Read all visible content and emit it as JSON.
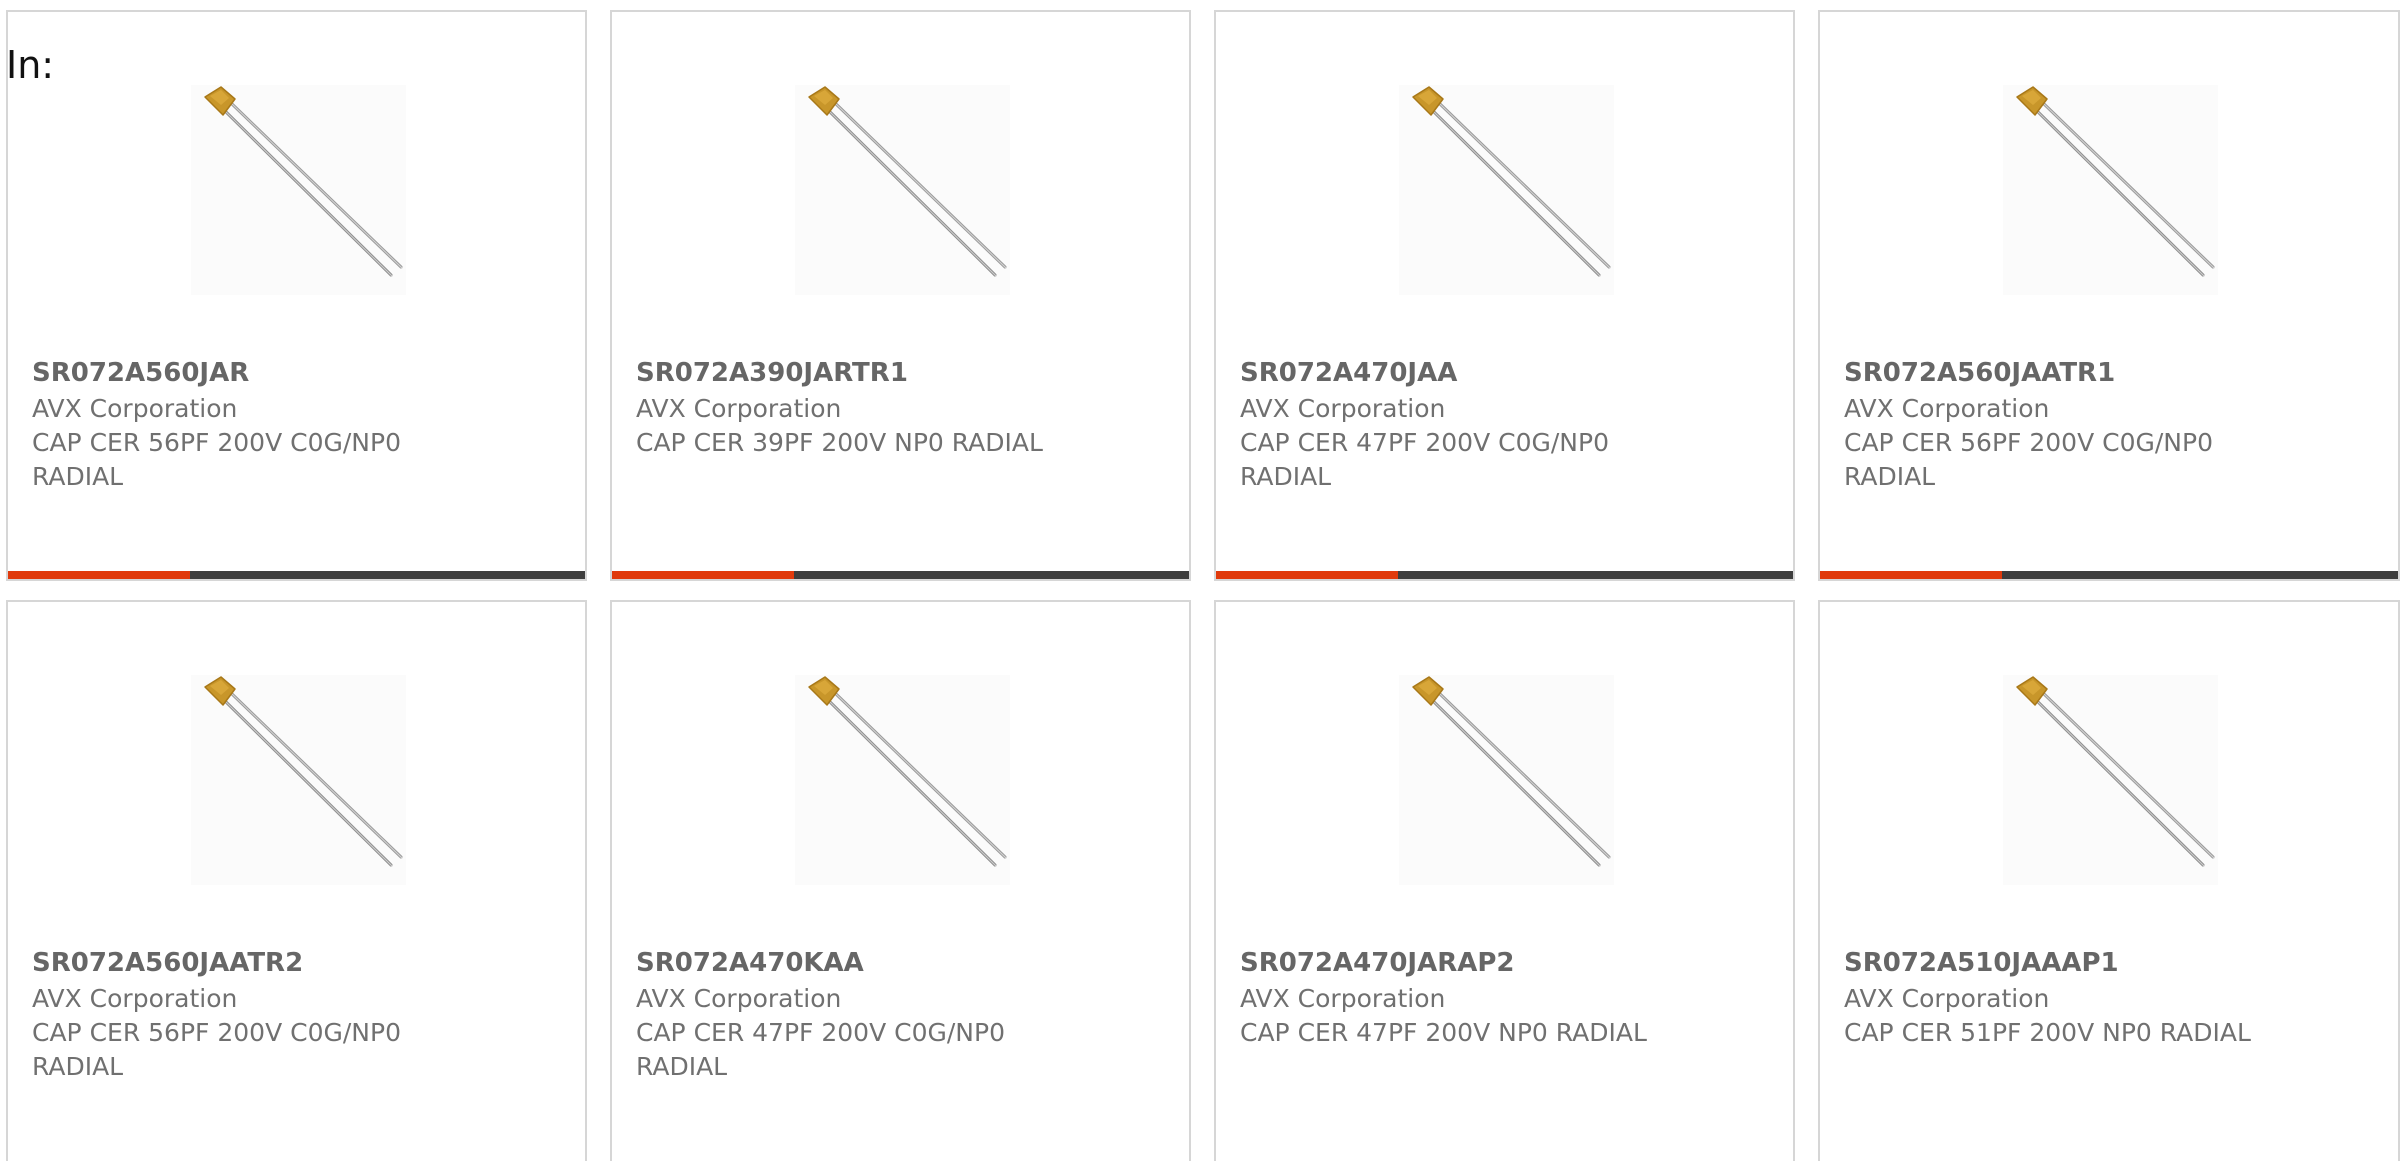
{
  "filter": {
    "label": "In:"
  },
  "cards": [
    {
      "part_number": "SR072A560JAR",
      "manufacturer": "AVX Corporation",
      "description": "CAP CER 56PF 200V C0G/NP0 RADIAL"
    },
    {
      "part_number": "SR072A390JARTR1",
      "manufacturer": "AVX Corporation",
      "description": "CAP CER 39PF 200V NP0 RADIAL"
    },
    {
      "part_number": "SR072A470JAA",
      "manufacturer": "AVX Corporation",
      "description": "CAP CER 47PF 200V C0G/NP0 RADIAL"
    },
    {
      "part_number": "SR072A560JAATR1",
      "manufacturer": "AVX Corporation",
      "description": "CAP CER 56PF 200V C0G/NP0 RADIAL"
    },
    {
      "part_number": "SR072A560JAATR2",
      "manufacturer": "AVX Corporation",
      "description": "CAP CER 56PF 200V C0G/NP0 RADIAL"
    },
    {
      "part_number": "SR072A470KAA",
      "manufacturer": "AVX Corporation",
      "description": "CAP CER 47PF 200V C0G/NP0 RADIAL"
    },
    {
      "part_number": "SR072A470JARAP2",
      "manufacturer": "AVX Corporation",
      "description": "CAP CER 47PF 200V NP0 RADIAL"
    },
    {
      "part_number": "SR072A510JAAAP1",
      "manufacturer": "AVX Corporation",
      "description": "CAP CER 51PF 200V NP0 RADIAL"
    }
  ],
  "colors": {
    "accent": "#e03a0c",
    "bar": "#3d3d3d",
    "border": "#d6d6d6",
    "part_text": "#666666",
    "body_text": "#707070"
  },
  "icons": {
    "product_image": "radial-capacitor-image"
  }
}
